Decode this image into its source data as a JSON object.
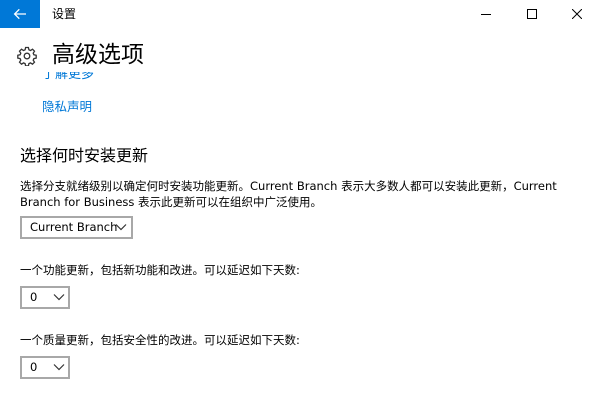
{
  "window": {
    "title": "设置",
    "icons": {
      "back": "back-arrow-icon",
      "minimize": "minimize-icon",
      "maximize": "maximize-icon",
      "close": "close-icon"
    },
    "accent_color": "#0078d7"
  },
  "header": {
    "icon": "gear-icon",
    "title": "高级选项"
  },
  "links": {
    "clipped_label": "了解更多",
    "privacy_label": "隐私声明",
    "color": "#0078d7"
  },
  "branch_section": {
    "heading": "选择何时安装更新",
    "description": "选择分支就绪级别以确定何时安装功能更新。Current Branch 表示大多数人都可以安装此更新，Current Branch for Business 表示此更新可以在组织中广泛使用。",
    "branch_select": {
      "value": "Current Branch",
      "icon": "chevron-down-icon"
    }
  },
  "feature_update": {
    "label": "一个功能更新，包括新功能和改进。可以延迟如下天数:",
    "select_value": "0"
  },
  "quality_update": {
    "label": "一个质量更新，包括安全性的改进。可以延迟如下天数:",
    "select_value": "0"
  }
}
